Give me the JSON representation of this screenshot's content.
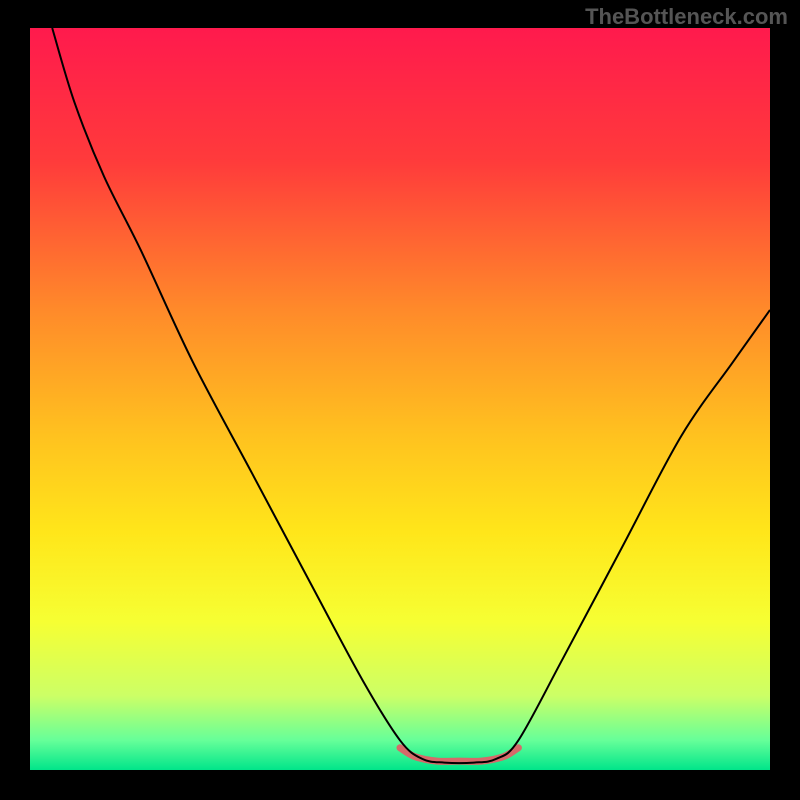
{
  "watermark": "TheBottleneck.com",
  "chart_data": {
    "type": "line",
    "title": "",
    "xlabel": "",
    "ylabel": "",
    "xlim": [
      0,
      100
    ],
    "ylim": [
      0,
      100
    ],
    "gradient_stops": [
      {
        "offset": 0,
        "color": "#ff1a4d"
      },
      {
        "offset": 18,
        "color": "#ff3b3b"
      },
      {
        "offset": 38,
        "color": "#ff8a2a"
      },
      {
        "offset": 55,
        "color": "#ffc21f"
      },
      {
        "offset": 68,
        "color": "#ffe61a"
      },
      {
        "offset": 80,
        "color": "#f6ff33"
      },
      {
        "offset": 90,
        "color": "#ccff66"
      },
      {
        "offset": 96,
        "color": "#66ff99"
      },
      {
        "offset": 100,
        "color": "#00e58a"
      }
    ],
    "series": [
      {
        "name": "bottleneck-curve",
        "color": "#000000",
        "points": [
          {
            "x": 3,
            "y": 100
          },
          {
            "x": 6,
            "y": 90
          },
          {
            "x": 10,
            "y": 80
          },
          {
            "x": 15,
            "y": 70
          },
          {
            "x": 22,
            "y": 55
          },
          {
            "x": 30,
            "y": 40
          },
          {
            "x": 38,
            "y": 25
          },
          {
            "x": 45,
            "y": 12
          },
          {
            "x": 50,
            "y": 4
          },
          {
            "x": 53,
            "y": 1.5
          },
          {
            "x": 56,
            "y": 1
          },
          {
            "x": 60,
            "y": 1
          },
          {
            "x": 63,
            "y": 1.5
          },
          {
            "x": 66,
            "y": 4
          },
          {
            "x": 72,
            "y": 15
          },
          {
            "x": 80,
            "y": 30
          },
          {
            "x": 88,
            "y": 45
          },
          {
            "x": 95,
            "y": 55
          },
          {
            "x": 100,
            "y": 62
          }
        ]
      },
      {
        "name": "flat-region-marker",
        "color": "#d66a6a",
        "stroke_width": 7,
        "points": [
          {
            "x": 50,
            "y": 3
          },
          {
            "x": 52,
            "y": 1.8
          },
          {
            "x": 55,
            "y": 1.2
          },
          {
            "x": 58,
            "y": 1.2
          },
          {
            "x": 61,
            "y": 1.2
          },
          {
            "x": 64,
            "y": 1.8
          },
          {
            "x": 66,
            "y": 3
          }
        ]
      }
    ]
  }
}
